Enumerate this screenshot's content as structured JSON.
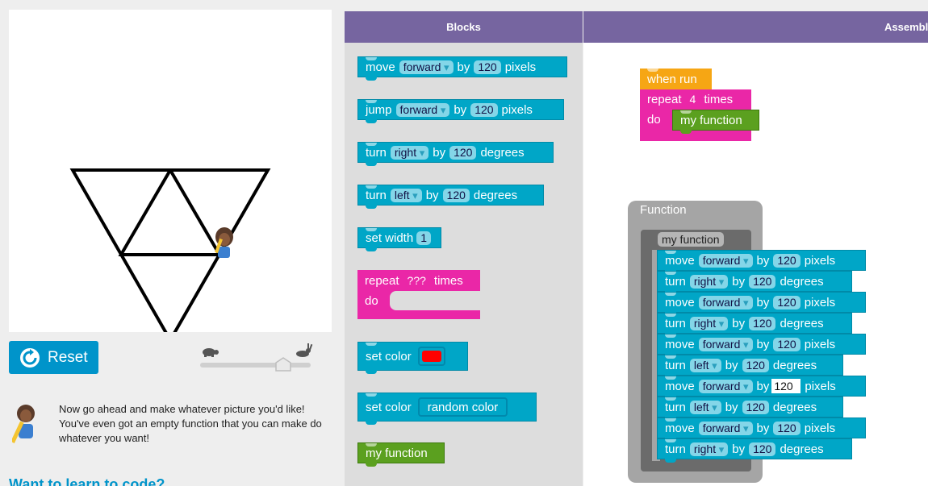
{
  "header": {
    "blocks_tab": "Blocks",
    "assembly_tab": "Assembl"
  },
  "left": {
    "reset_label": "Reset",
    "instructions": "Now go ahead and make whatever picture you'd like! You've even got an empty function that you can make do whatever you want!",
    "learn_link": "Want to learn to code?"
  },
  "toolbox": {
    "move": {
      "word": "move",
      "dir": "forward",
      "by": "by",
      "value": "120",
      "unit": "pixels"
    },
    "jump": {
      "word": "jump",
      "dir": "forward",
      "by": "by",
      "value": "120",
      "unit": "pixels"
    },
    "turn_right": {
      "word": "turn",
      "dir": "right",
      "by": "by",
      "value": "120",
      "unit": "degrees"
    },
    "turn_left": {
      "word": "turn",
      "dir": "left",
      "by": "by",
      "value": "120",
      "unit": "degrees"
    },
    "set_width": {
      "word": "set width",
      "value": "1"
    },
    "repeat": {
      "word": "repeat",
      "value": "???",
      "times": "times",
      "do": "do"
    },
    "set_color": {
      "word": "set color",
      "color": "#ff0000"
    },
    "set_color_random": {
      "word": "set color",
      "value": "random color"
    },
    "my_function": "my function"
  },
  "workspace": {
    "when_run": "when run",
    "repeat_word": "repeat",
    "repeat_value": "4",
    "repeat_times": "times",
    "do": "do",
    "call": "my function",
    "function_title": "Function",
    "function_name": "my function",
    "body": [
      {
        "word": "move",
        "dir": "forward",
        "by": "by",
        "value": "120",
        "unit": "pixels"
      },
      {
        "word": "turn",
        "dir": "right",
        "by": "by",
        "value": "120",
        "unit": "degrees"
      },
      {
        "word": "move",
        "dir": "forward",
        "by": "by",
        "value": "120",
        "unit": "pixels"
      },
      {
        "word": "turn",
        "dir": "right",
        "by": "by",
        "value": "120",
        "unit": "degrees"
      },
      {
        "word": "move",
        "dir": "forward",
        "by": "by",
        "value": "120",
        "unit": "pixels"
      },
      {
        "word": "turn",
        "dir": "left",
        "by": "by",
        "value": "120",
        "unit": "degrees"
      },
      {
        "word": "move",
        "dir": "forward",
        "by": "by",
        "value": "120",
        "unit": "pixels"
      },
      {
        "word": "turn",
        "dir": "left",
        "by": "by",
        "value": "120",
        "unit": "degrees"
      },
      {
        "word": "move",
        "dir": "forward",
        "by": "by",
        "value": "120",
        "unit": "pixels"
      },
      {
        "word": "turn",
        "dir": "right",
        "by": "by",
        "value": "120",
        "unit": "degrees"
      }
    ]
  },
  "colors": {
    "teal": "#00a6c7",
    "pink": "#ea27a7",
    "green": "#5ba01f",
    "orange": "#f6a614",
    "purple": "#7665a0",
    "reset_blue": "#0094ca"
  }
}
